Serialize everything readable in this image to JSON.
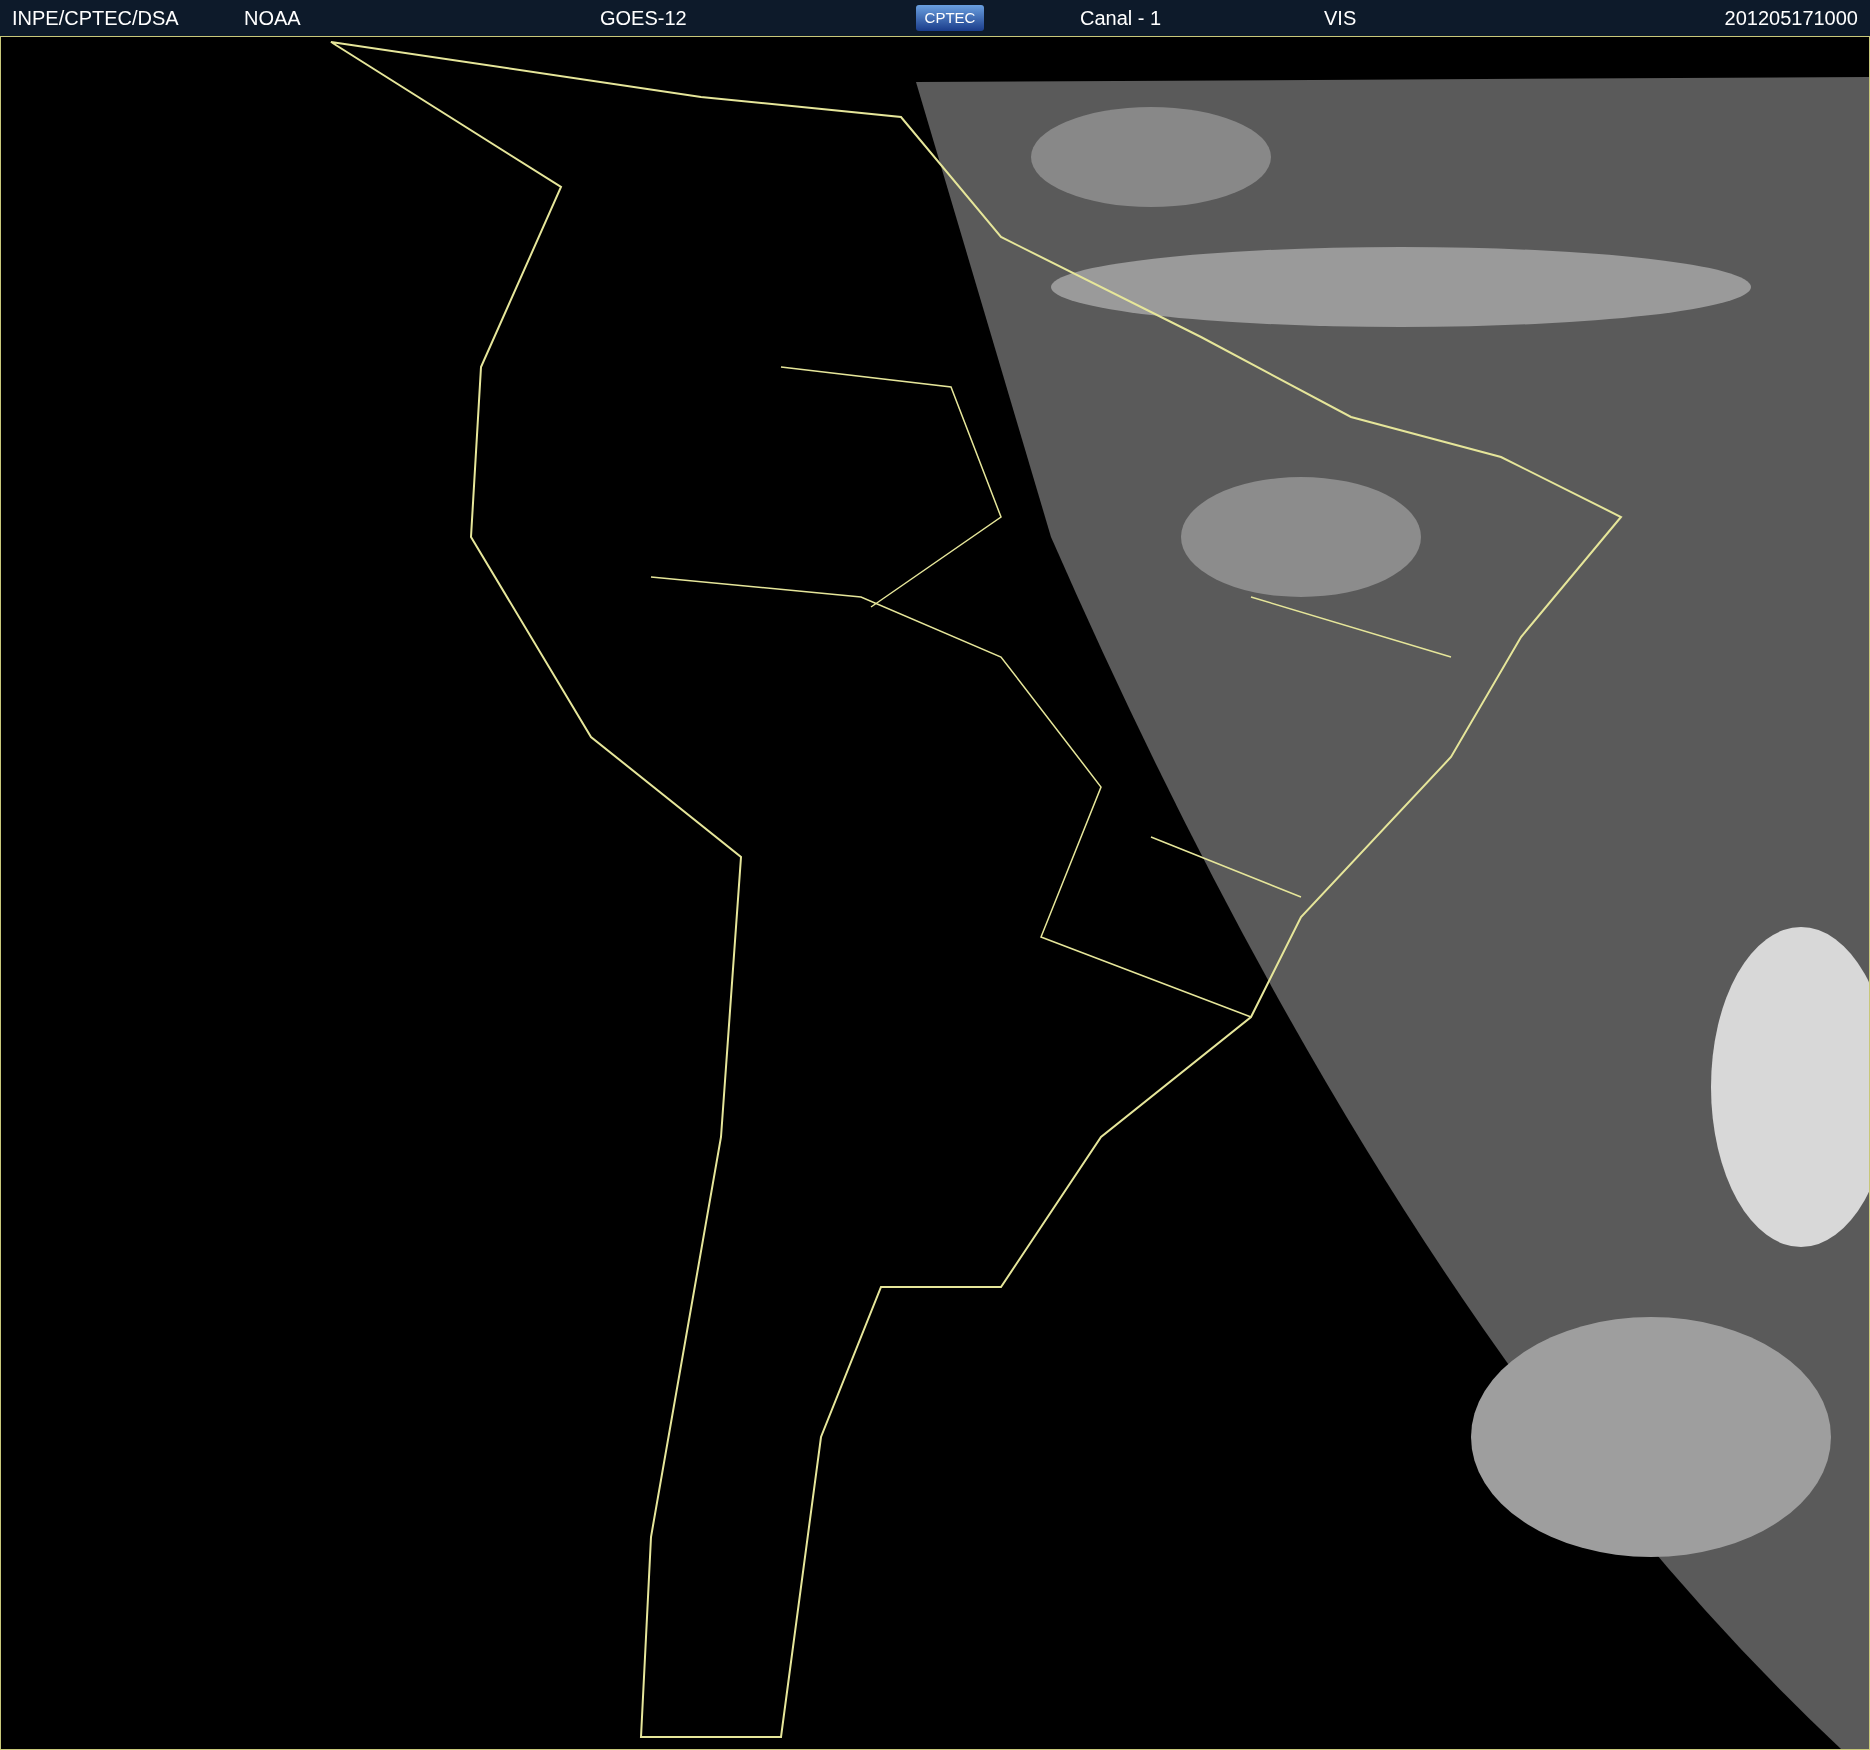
{
  "header": {
    "items": [
      {
        "kind": "text",
        "text": "INPE/CPTEC/DSA"
      },
      {
        "kind": "text",
        "text": "NOAA"
      },
      {
        "kind": "text",
        "text": "GOES-12"
      },
      {
        "kind": "logo",
        "text": "CPTEC"
      },
      {
        "kind": "text",
        "text": "Canal - 1"
      },
      {
        "kind": "text",
        "text": "VIS"
      },
      {
        "kind": "text",
        "text": "201205171000"
      }
    ]
  }
}
